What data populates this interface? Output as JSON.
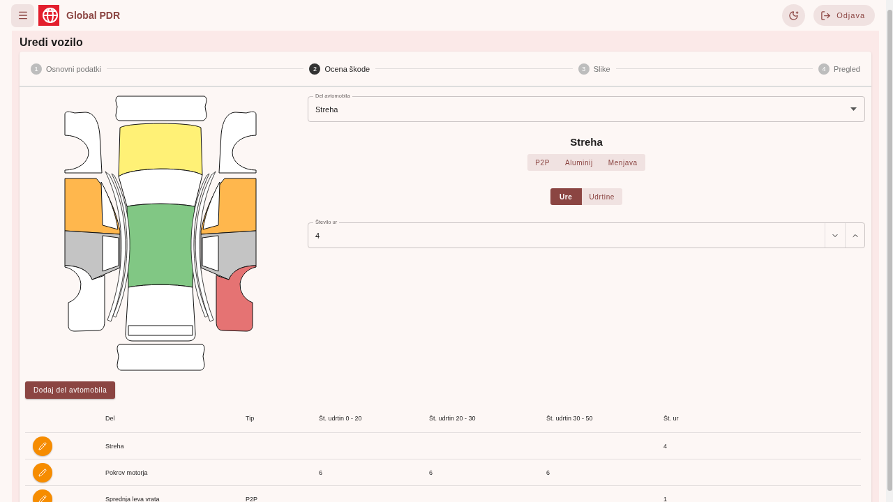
{
  "app_bar": {
    "brand": "Global PDR",
    "logout": "Odjava"
  },
  "page_title": "Uredi vozilo",
  "stepper": [
    {
      "number": "1",
      "label": "Osnovni podatki",
      "selected": false
    },
    {
      "number": "2",
      "label": "Ocena škode",
      "selected": true
    },
    {
      "number": "3",
      "label": "Slike",
      "selected": false
    },
    {
      "number": "4",
      "label": "Pregled",
      "selected": false
    }
  ],
  "car_parts": [
    {
      "kind": "front-bumper",
      "color": "#ffffff"
    },
    {
      "kind": "hood",
      "color": "#fff176"
    },
    {
      "kind": "windshield",
      "color": "#ffffff"
    },
    {
      "kind": "roof",
      "color": "#81c784"
    },
    {
      "kind": "trunk",
      "color": "#ffffff"
    },
    {
      "kind": "rear-bumper",
      "color": "#ffffff"
    },
    {
      "kind": "left-front-fender",
      "color": "#ffffff"
    },
    {
      "kind": "left-front-door",
      "color": "#ffb74d"
    },
    {
      "kind": "left-rear-door",
      "color": "#c4c4c4"
    },
    {
      "kind": "left-rear-fender",
      "color": "#ffffff"
    },
    {
      "kind": "right-front-fender",
      "color": "#ffffff"
    },
    {
      "kind": "right-front-door",
      "color": "#ffb74d"
    },
    {
      "kind": "right-rear-door",
      "color": "#c4c4c4"
    },
    {
      "kind": "right-rear-fender",
      "color": "#e57373"
    }
  ],
  "part_select": {
    "label": "Del avtomobila",
    "value": "Streha"
  },
  "part_heading": "Streha",
  "repair_types": [
    {
      "label": "P2P",
      "selected": false
    },
    {
      "label": "Aluminij",
      "selected": false
    },
    {
      "label": "Menjava",
      "selected": false
    }
  ],
  "mode_toggle": [
    {
      "label": "Ure",
      "selected": true
    },
    {
      "label": "Udrtine",
      "selected": false
    }
  ],
  "hours_field": {
    "label": "Število ur",
    "value": "4"
  },
  "add_button": "Dodaj del avtomobila",
  "table": {
    "columns": [
      "Del",
      "Tip",
      "Št. udrtin 0 - 20",
      "Št. udrtin 20 - 30",
      "Št. udrtin 30 - 50",
      "Št. ur"
    ],
    "rows": [
      {
        "cells": [
          "Streha",
          null,
          null,
          null,
          null,
          "4"
        ]
      },
      {
        "cells": [
          "Pokrov motorja",
          null,
          "6",
          "6",
          "6",
          null
        ]
      },
      {
        "cells": [
          "Sprednja leva vrata",
          "P2P",
          null,
          null,
          null,
          "1"
        ]
      }
    ]
  }
}
